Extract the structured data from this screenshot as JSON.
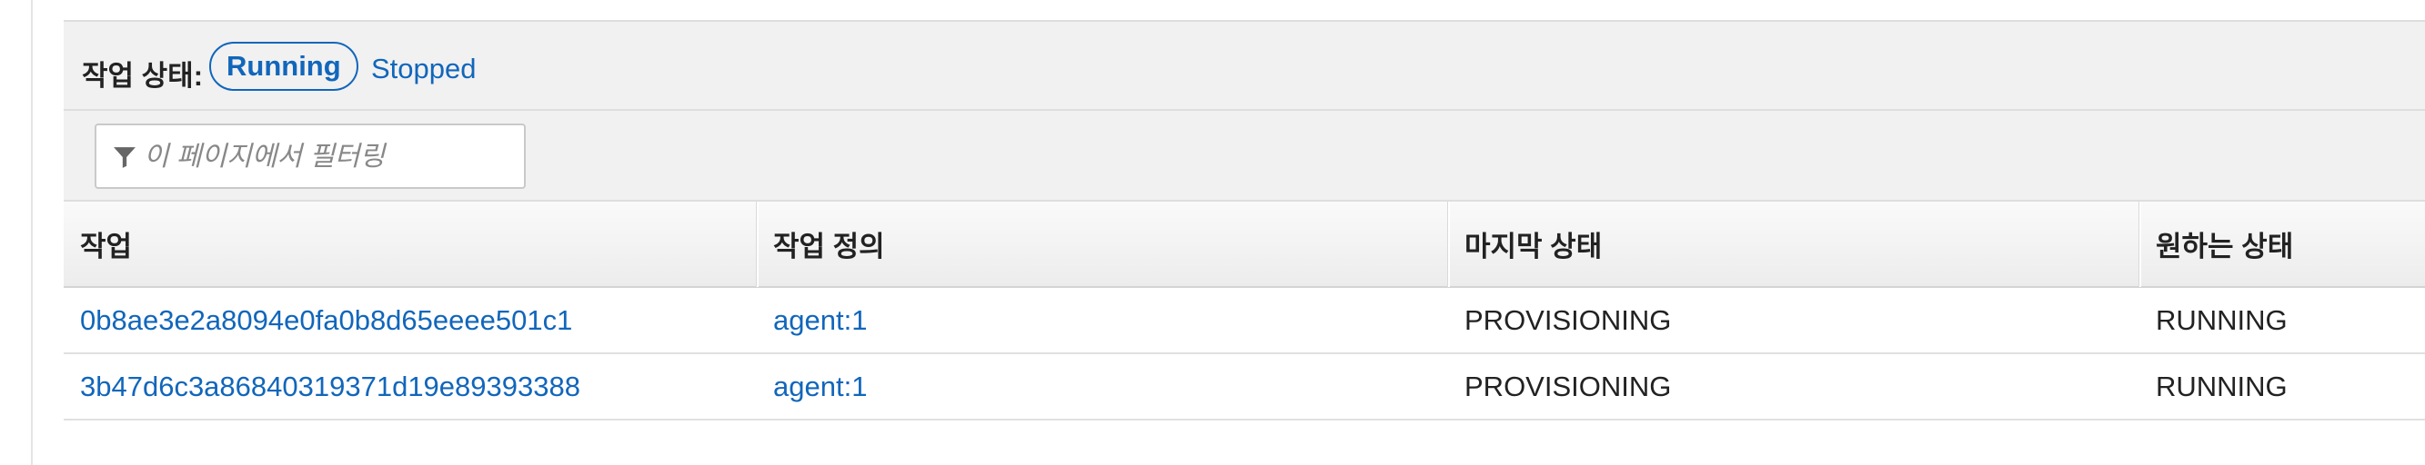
{
  "status_filter": {
    "label": "작업 상태:",
    "options": [
      "Running",
      "Stopped"
    ],
    "selected": "Running"
  },
  "filter": {
    "placeholder": "이 페이지에서 필터링",
    "value": "",
    "icon": "filter-icon"
  },
  "table": {
    "columns": [
      "작업",
      "작업 정의",
      "마지막 상태",
      "원하는 상태"
    ],
    "rows": [
      {
        "task": "0b8ae3e2a8094e0fa0b8d65eeee501c1",
        "task_definition": "agent:1",
        "last_status": "PROVISIONING",
        "desired_status": "RUNNING"
      },
      {
        "task": "3b47d6c3a86840319371d19e89393388",
        "task_definition": "agent:1",
        "last_status": "PROVISIONING",
        "desired_status": "RUNNING"
      }
    ]
  },
  "colors": {
    "link": "#1166bb",
    "panel_bg": "#f1f1f1"
  }
}
